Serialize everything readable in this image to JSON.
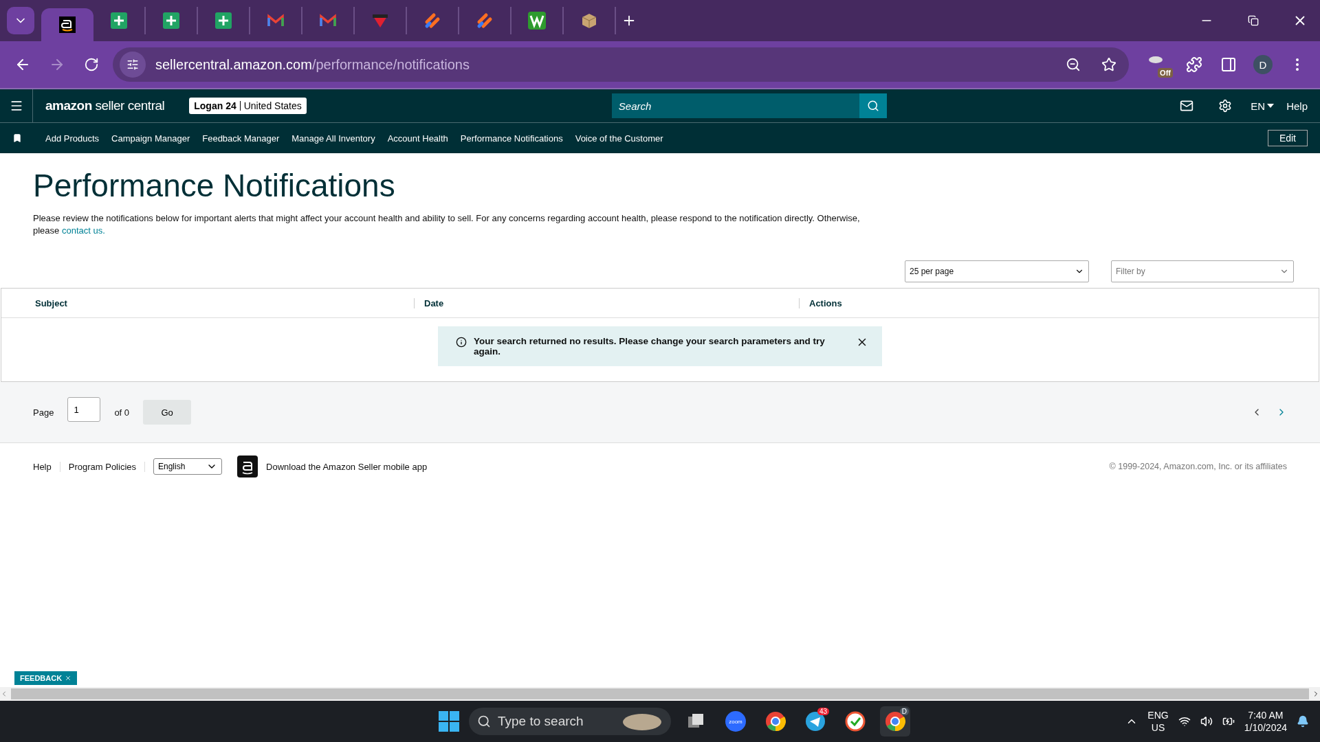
{
  "browser": {
    "tabs": [
      {
        "kind": "amazon",
        "selected": true
      },
      {
        "kind": "sheets",
        "selected": false
      },
      {
        "kind": "sheets",
        "selected": false
      },
      {
        "kind": "sheets",
        "selected": false
      },
      {
        "kind": "gmail",
        "selected": false
      },
      {
        "kind": "gmail",
        "selected": false
      },
      {
        "kind": "shield",
        "selected": false
      },
      {
        "kind": "slashes",
        "selected": false
      },
      {
        "kind": "slashes",
        "selected": false
      },
      {
        "kind": "wlogo",
        "selected": false
      },
      {
        "kind": "box",
        "selected": false
      }
    ],
    "url_host": "sellercentral.amazon.com",
    "url_path": "/performance/notifications",
    "extension_badge": "Off",
    "profile_initial": "D"
  },
  "header": {
    "logo_word": "amazon",
    "logo_rest": "seller central",
    "account_name": "Logan 24",
    "account_region": "United States",
    "search_placeholder": "Search",
    "language": "EN",
    "help": "Help"
  },
  "nav": {
    "items": [
      "Add Products",
      "Campaign Manager",
      "Feedback Manager",
      "Manage All Inventory",
      "Account Health",
      "Performance Notifications",
      "Voice of the Customer"
    ],
    "edit": "Edit"
  },
  "page": {
    "title": "Performance Notifications",
    "description": "Please review the notifications below for important alerts that might affect your account health and ability to sell. For any concerns regarding account health, please respond to the notification directly. Otherwise, please",
    "link": "contact us.",
    "per_page": "25 per page",
    "filter_placeholder": "Filter by"
  },
  "table": {
    "columns": [
      "Subject",
      "Date",
      "Actions"
    ],
    "alert": "Your search returned no results. Please change your search parameters and try again."
  },
  "pagination": {
    "page_label": "Page",
    "page_value": "1",
    "of_label": "of 0",
    "go": "Go"
  },
  "footer": {
    "links": [
      "Help",
      "Program Policies"
    ],
    "language": "English",
    "app_text": "Download the Amazon Seller mobile app",
    "copyright": "© 1999-2024, Amazon.com, Inc. or its affiliates"
  },
  "feedback": "FEEDBACK",
  "taskbar": {
    "search_placeholder": "Type to search",
    "apps": [
      {
        "kind": "files",
        "selected": false
      },
      {
        "kind": "zoom",
        "label": "zoom",
        "selected": false
      },
      {
        "kind": "chrome",
        "selected": false
      },
      {
        "kind": "telegram",
        "badge": "43",
        "selected": false
      },
      {
        "kind": "check",
        "selected": false
      },
      {
        "kind": "chrome",
        "badge": "D",
        "selected": true
      }
    ],
    "lang": "ENG",
    "region": "US",
    "time": "7:40 AM",
    "date": "1/10/2024"
  }
}
